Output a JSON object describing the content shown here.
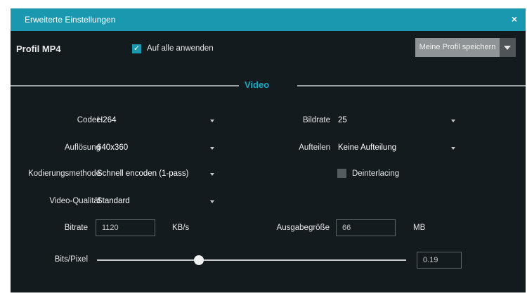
{
  "dialog": {
    "title": "Erweiterte Einstellungen",
    "close_label": "×"
  },
  "header": {
    "profile_name": "Profil MP4",
    "apply_all_label": "Auf alle anwenden",
    "apply_all_checked": true,
    "save_button_label": "Meine Profil speichern"
  },
  "section": {
    "title": "Video"
  },
  "fields": {
    "codec": {
      "label": "Codec",
      "value": "H264"
    },
    "framerate": {
      "label": "Bildrate",
      "value": "25"
    },
    "resolution": {
      "label": "Auflösung",
      "value": "640x360"
    },
    "split": {
      "label": "Aufteilen",
      "value": "Keine Aufteilung"
    },
    "encoding": {
      "label": "Kodierungsmethode",
      "value": "Schnell encoden (1-pass)"
    },
    "deinterlacing": {
      "label": "Deinterlacing",
      "checked": false
    },
    "quality": {
      "label": "Video-Qualität",
      "value": "Standard"
    },
    "bitrate": {
      "label": "Bitrate",
      "value": "1120",
      "unit": "KB/s"
    },
    "output_size": {
      "label": "Ausgabegröße",
      "value": "66",
      "unit": "MB"
    },
    "bits_pixel": {
      "label": "Bits/Pixel",
      "value": "0.19",
      "slider_fraction": 0.33
    }
  },
  "colors": {
    "accent": "#1a98b0",
    "background": "#141b1f",
    "titlebar": "#1a98b0"
  },
  "icons": {
    "close": "close-icon",
    "checkbox": "check-icon",
    "dropdown": "chevron-down-icon"
  }
}
